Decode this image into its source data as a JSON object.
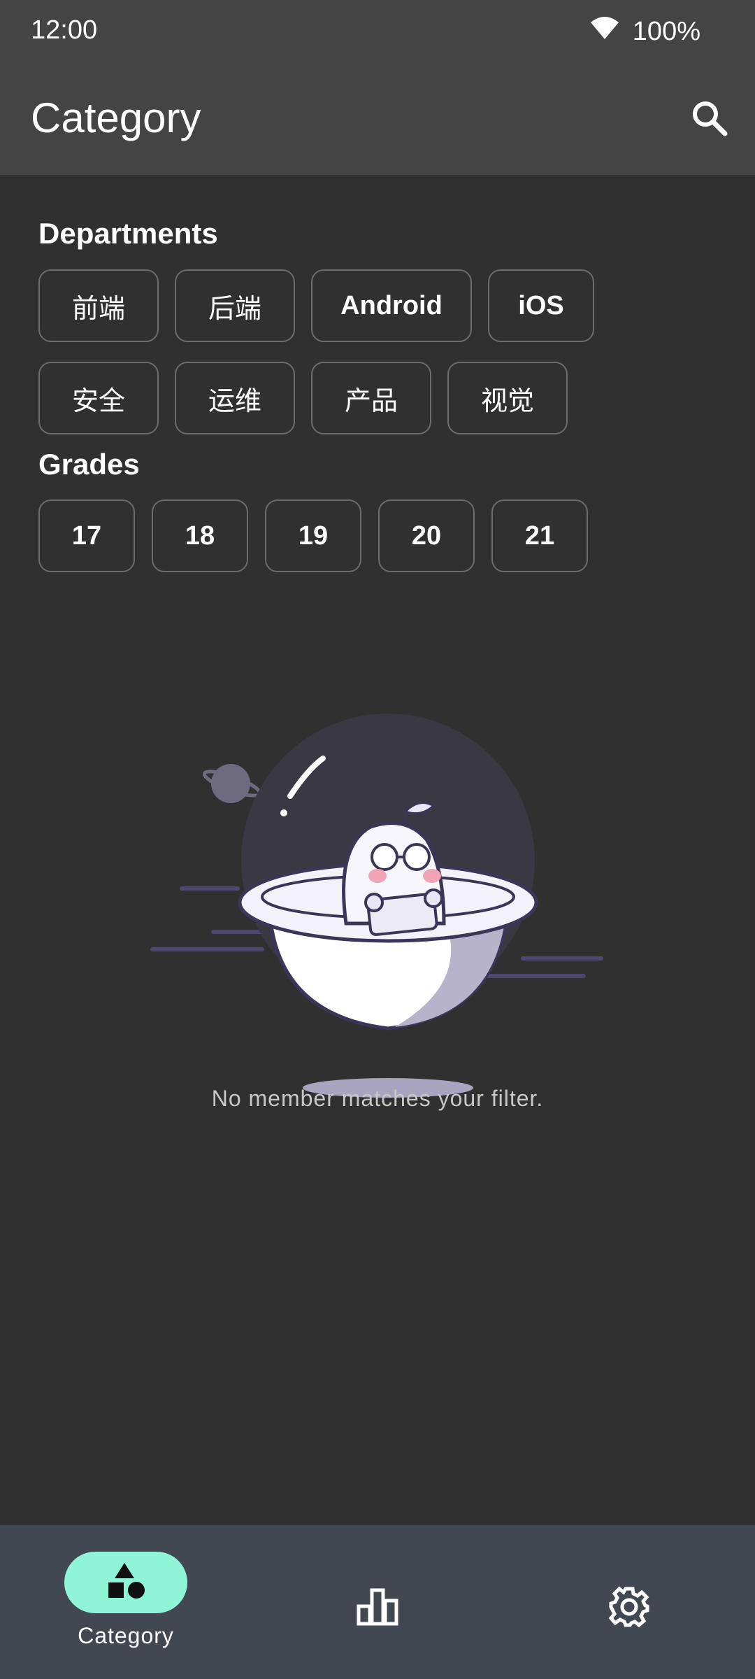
{
  "status_bar": {
    "time": "12:00",
    "battery": "100%",
    "icons": [
      "wifi-icon"
    ]
  },
  "app_bar": {
    "title": "Category",
    "search_icon": "search-icon"
  },
  "departments": {
    "title": "Departments",
    "chips": [
      "前端",
      "后端",
      "Android",
      "iOS",
      "安全",
      "运维",
      "产品",
      "视觉"
    ]
  },
  "grades": {
    "title": "Grades",
    "chips": [
      "17",
      "18",
      "19",
      "20",
      "21"
    ]
  },
  "empty_state": {
    "message": "No member matches your filter.",
    "illustration": "robot-in-planet-illustration"
  },
  "bottom_nav": {
    "items": [
      {
        "label": "Category",
        "icon": "shapes-icon",
        "selected": true
      },
      {
        "label": "",
        "icon": "leaderboard-icon",
        "selected": false
      },
      {
        "label": "",
        "icon": "gear-icon",
        "selected": false
      }
    ]
  },
  "colors": {
    "app_bar": "#444444",
    "background": "#303030",
    "nav_bar": "#424851",
    "nav_indicator": "#8ff5d6"
  }
}
